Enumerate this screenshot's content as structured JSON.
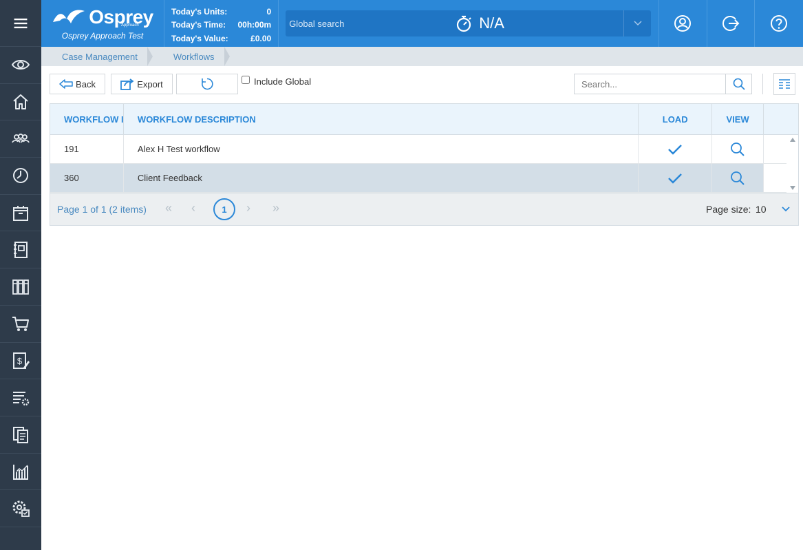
{
  "header": {
    "brand_name": "Osprey",
    "brand_sub": "Approach",
    "brand_caption": "Osprey Approach Test",
    "stats": [
      {
        "label": "Today's Units:",
        "value": "0"
      },
      {
        "label": "Today's Time:",
        "value": "00h:00m"
      },
      {
        "label": "Today's Value:",
        "value": "£0.00"
      }
    ],
    "global_search_placeholder": "Global search",
    "timer_value": "N/A",
    "buttons": [
      "profile-icon",
      "logout-icon",
      "help-icon"
    ]
  },
  "sidebar": {
    "items": [
      "menu-icon",
      "eye-icon",
      "home-icon",
      "contacts-icon",
      "time-icon",
      "case-icon",
      "notebook-icon",
      "library-icon",
      "cart-icon",
      "billing-icon",
      "settings-list-icon",
      "documents-icon",
      "reports-icon",
      "admin-icon"
    ]
  },
  "breadcrumb": [
    "Case Management",
    "Workflows"
  ],
  "toolbar": {
    "back_label": "Back",
    "export_label": "Export",
    "include_global_label": "Include Global",
    "search_placeholder": "Search..."
  },
  "grid": {
    "columns": [
      "WORKFLOW ID",
      "WORKFLOW DESCRIPTION",
      "LOAD",
      "VIEW"
    ],
    "rows": [
      {
        "id": "191",
        "description": "Alex H Test workflow"
      },
      {
        "id": "360",
        "description": "Client Feedback"
      }
    ],
    "pager": {
      "info": "Page 1 of 1 (2 items)",
      "current_page": "1",
      "page_size_label": "Page size:",
      "page_size": "10"
    }
  },
  "colors": {
    "header_blue": "#2b88d8",
    "sidebar_dark": "#2e3b4a",
    "selected_row": "#d3dee7"
  }
}
